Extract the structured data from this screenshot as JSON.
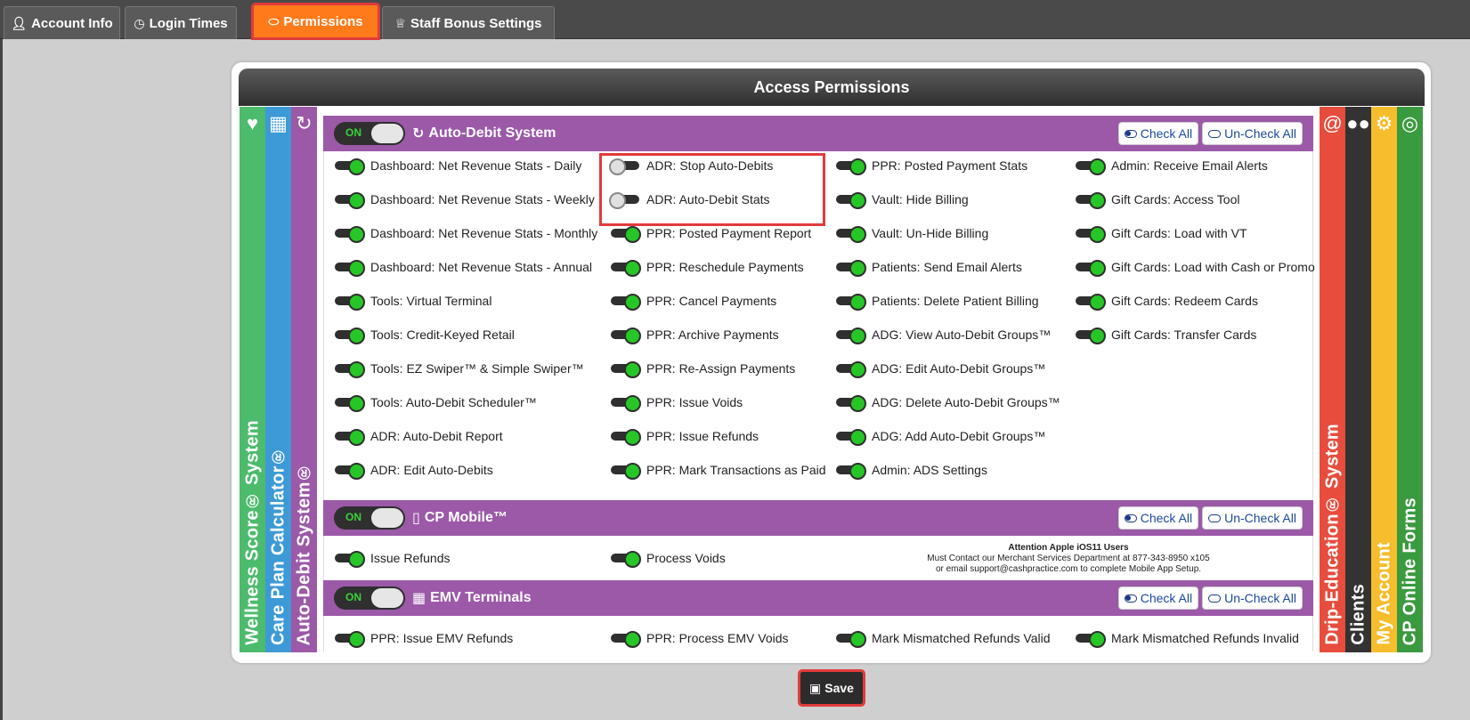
{
  "tabs": [
    {
      "label": "Account Info",
      "icon": "user-icon"
    },
    {
      "label": "Login Times",
      "icon": "clock-icon"
    },
    {
      "label": "Permissions",
      "icon": "toggle-icon",
      "active": true
    },
    {
      "label": "Staff Bonus Settings",
      "icon": "trophy-icon"
    }
  ],
  "panel": {
    "title": "Access Permissions"
  },
  "left_bars": [
    {
      "label": "Wellness Score® System",
      "icon": "heartbeat-icon",
      "color": "#4cbb6c"
    },
    {
      "label": "Care Plan Calculator®",
      "icon": "calculator-icon",
      "color": "#3d9ad6"
    },
    {
      "label": "Auto-Debit System®",
      "icon": "refresh-icon",
      "color": "#9b59a8"
    }
  ],
  "right_bars": [
    {
      "label": "Drip-Education® System",
      "icon": "at-icon",
      "color": "#e74c3c"
    },
    {
      "label": "Clients",
      "icon": "users-icon",
      "color": "#333333"
    },
    {
      "label": "My Account",
      "icon": "gear-icon",
      "color": "#f6bd2c"
    },
    {
      "label": "CP Online Forms",
      "icon": "globe-icon",
      "color": "#3a9a3f"
    }
  ],
  "toggle_on_label": "ON",
  "check_all_label": "Check All",
  "uncheck_all_label": "Un-Check All",
  "sections": {
    "auto_debit": {
      "title": "Auto-Debit System",
      "columns": [
        [
          "Dashboard: Net Revenue Stats - Daily",
          "Dashboard: Net Revenue Stats - Weekly",
          "Dashboard: Net Revenue Stats - Monthly",
          "Dashboard: Net Revenue Stats - Annual",
          "Tools: Virtual Terminal",
          "Tools: Credit-Keyed Retail",
          "Tools: EZ Swiper™ & Simple Swiper™",
          "Tools: Auto-Debit Scheduler™",
          "ADR: Auto-Debit Report",
          "ADR: Edit Auto-Debits"
        ],
        [
          "ADR: Stop Auto-Debits",
          "ADR: Auto-Debit Stats",
          "PPR: Posted Payment Report",
          "PPR: Reschedule Payments",
          "PPR: Cancel Payments",
          "PPR: Archive Payments",
          "PPR: Re-Assign Payments",
          "PPR: Issue Voids",
          "PPR: Issue Refunds",
          "PPR: Mark Transactions as Paid"
        ],
        [
          "PPR: Posted Payment Stats",
          "Vault: Hide Billing",
          "Vault: Un-Hide Billing",
          "Patients: Send Email Alerts",
          "Patients: Delete Patient Billing",
          "ADG: View Auto-Debit Groups™",
          "ADG: Edit Auto-Debit Groups™",
          "ADG: Delete Auto-Debit Groups™",
          "ADG: Add Auto-Debit Groups™",
          "Admin: ADS Settings"
        ],
        [
          "Admin: Receive Email Alerts",
          "Gift Cards: Access Tool",
          "Gift Cards: Load with VT",
          "Gift Cards: Load with Cash or Promo",
          "Gift Cards: Redeem Cards",
          "Gift Cards: Transfer Cards"
        ]
      ],
      "off_items": [
        "ADR: Stop Auto-Debits",
        "ADR: Auto-Debit Stats"
      ]
    },
    "cp_mobile": {
      "title": "CP Mobile™",
      "items": [
        "Issue Refunds",
        "Process Voids"
      ],
      "note": {
        "heading": "Attention Apple iOS11 Users",
        "line1": "Must Contact our Merchant Services Department at 877-343-8950 x105",
        "line2": "or email support@cashpractice.com to complete Mobile App Setup."
      }
    },
    "emv": {
      "title": "EMV Terminals",
      "items": [
        "PPR: Issue EMV Refunds",
        "PPR: Process EMV Voids",
        "Mark Mismatched Refunds Valid",
        "Mark Mismatched Refunds Invalid"
      ]
    }
  },
  "save_label": "Save"
}
